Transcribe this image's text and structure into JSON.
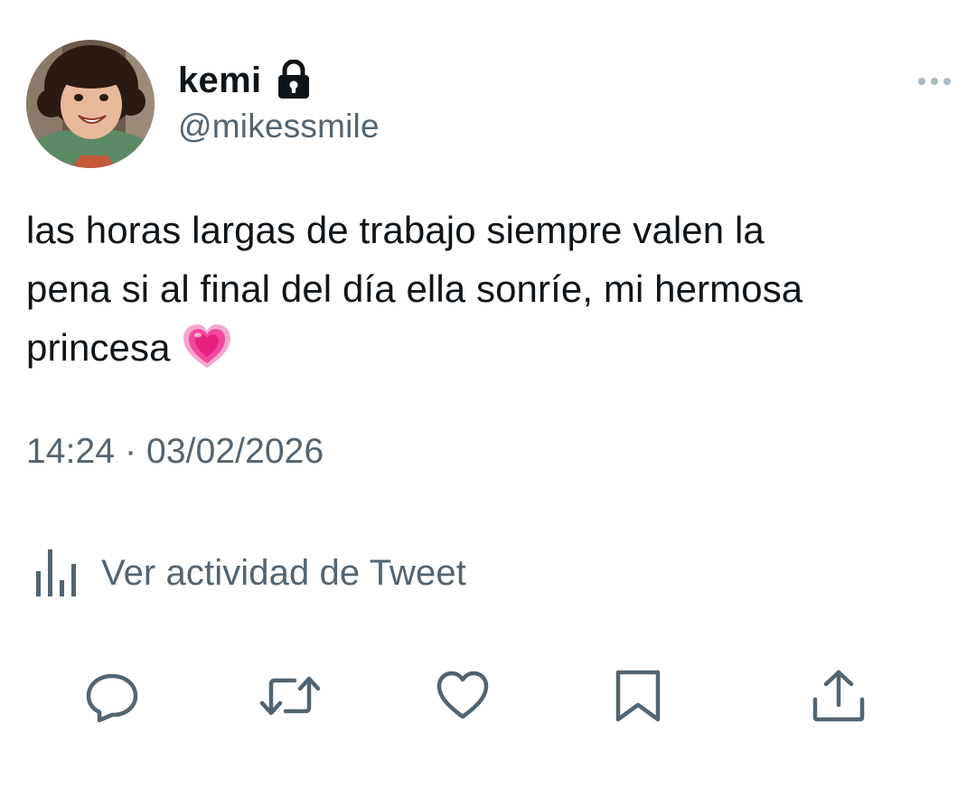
{
  "author": {
    "display_name": "kemi",
    "handle": "@mikessmile",
    "protected": true
  },
  "tweet": {
    "text_line1": "las horas largas de trabajo siempre valen la",
    "text_line2": "pena si al final del día ella sonríe, mi hermosa",
    "text_line3": "princesa",
    "emoji": "growing-heart-icon",
    "timestamp": "14:24 · 03/02/2026"
  },
  "activity": {
    "label": "Ver actividad de Tweet"
  },
  "actions": [
    {
      "name": "reply",
      "icon": "reply-icon"
    },
    {
      "name": "retweet",
      "icon": "retweet-icon"
    },
    {
      "name": "like",
      "icon": "heart-icon"
    },
    {
      "name": "bookmark",
      "icon": "bookmark-icon"
    },
    {
      "name": "share",
      "icon": "share-icon"
    }
  ],
  "colors": {
    "text_primary": "#0f1419",
    "text_secondary": "#536471",
    "icon_gray": "#536471",
    "emoji_pink": "#f3469c"
  }
}
